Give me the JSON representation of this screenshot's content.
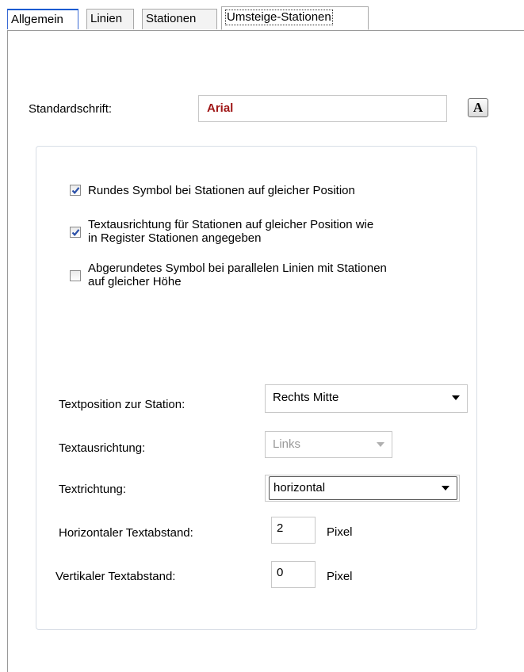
{
  "tabs": [
    {
      "label": "Allgemein"
    },
    {
      "label": "Linien"
    },
    {
      "label": "Stationen"
    },
    {
      "label": "Umsteige-Stationen"
    }
  ],
  "font": {
    "label": "Standardschrift:",
    "value": "Arial",
    "button_label": "A",
    "value_color": "#a01818"
  },
  "checkboxes": [
    {
      "label": "Rundes Symbol bei Stationen auf gleicher Position",
      "checked": true
    },
    {
      "label_line1": "Textausrichtung für Stationen auf gleicher Position wie",
      "label_line2": "in Register Stationen angegeben",
      "checked": true
    },
    {
      "label_line1": "Abgerundetes Symbol bei parallelen Linien mit Stationen",
      "label_line2": "auf gleicher Höhe",
      "checked": false
    }
  ],
  "fields": {
    "textposition": {
      "label": "Textposition zur Station:",
      "value": "Rechts Mitte"
    },
    "textausrichtung": {
      "label": "Textausrichtung:",
      "value": "Links",
      "disabled": true
    },
    "textrichtung": {
      "label": "Textrichtung:",
      "value": "horizontal"
    },
    "horizontal_abstand": {
      "label": "Horizontaler Textabstand:",
      "value": "2",
      "unit": "Pixel"
    },
    "vertikal_abstand": {
      "label": "Vertikaler Textabstand:",
      "value": "0",
      "unit": "Pixel"
    }
  },
  "colors": {
    "checkbox_check": "#2a4fa8",
    "tab_active_border": "#1a5bd1"
  }
}
